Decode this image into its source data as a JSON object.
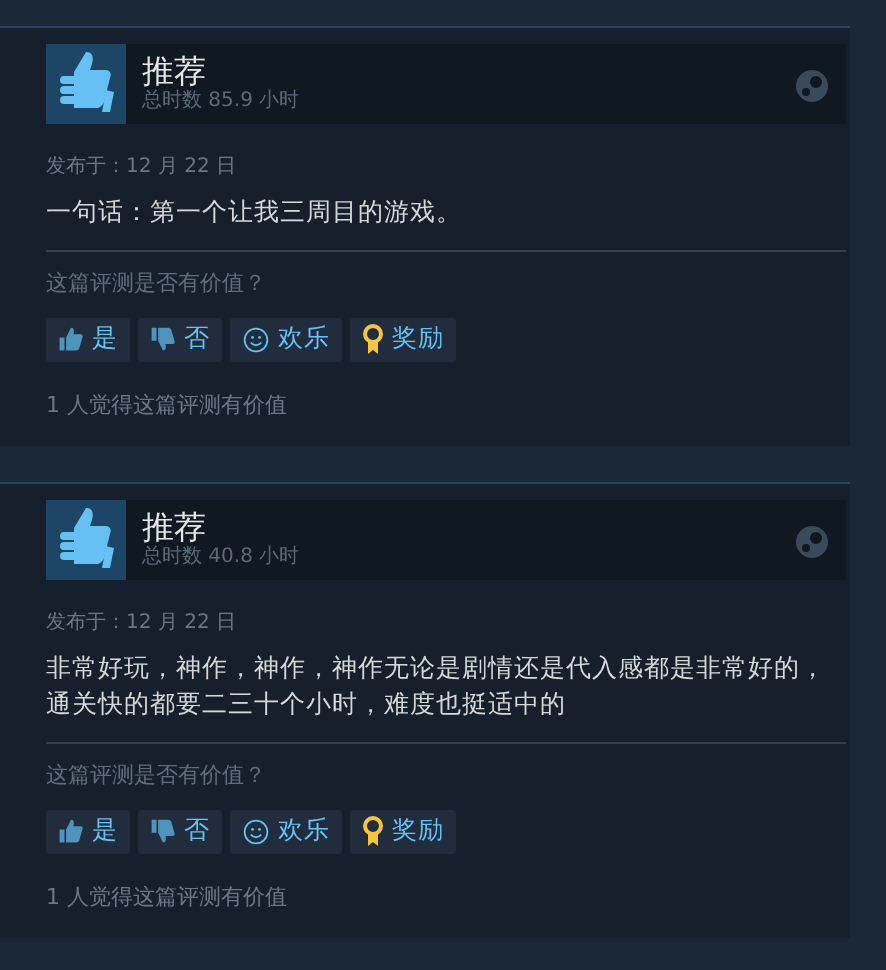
{
  "reviews": [
    {
      "verdict": "推荐",
      "hours": "总时数 85.9 小时",
      "posted": "发布于：12 月 22 日",
      "text": "一句话：第一个让我三周目的游戏。",
      "question": "这篇评测是否有价值？",
      "buttons": [
        {
          "kind": "up",
          "label": "是"
        },
        {
          "kind": "down",
          "label": "否"
        },
        {
          "kind": "funny",
          "label": "欢乐"
        },
        {
          "kind": "award",
          "label": "奖励"
        }
      ],
      "helpful": "1 人觉得这篇评测有价值"
    },
    {
      "verdict": "推荐",
      "hours": "总时数 40.8 小时",
      "posted": "发布于：12 月 22 日",
      "text": "非常好玩，神作，神作，神作无论是剧情还是代入感都是非常好的，通关快的都要二三十个小时，难度也挺适中的",
      "question": "这篇评测是否有价值？",
      "buttons": [
        {
          "kind": "up",
          "label": "是"
        },
        {
          "kind": "down",
          "label": "否"
        },
        {
          "kind": "funny",
          "label": "欢乐"
        },
        {
          "kind": "award",
          "label": "奖励"
        }
      ],
      "helpful": "1 人觉得这篇评测有价值"
    }
  ]
}
